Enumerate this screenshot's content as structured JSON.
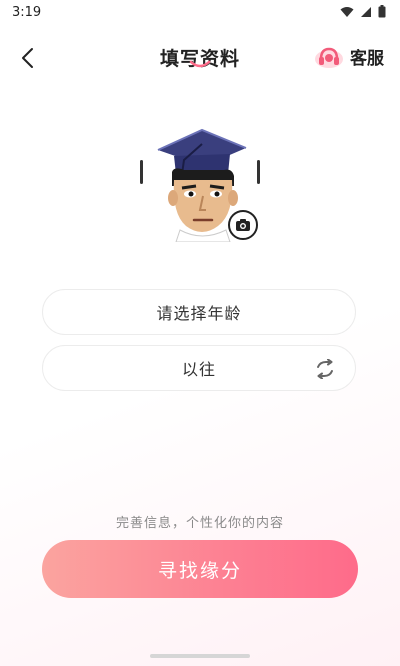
{
  "status_bar": {
    "time": "3:19",
    "icons": [
      "wifi-icon",
      "signal-icon",
      "battery-icon"
    ]
  },
  "nav": {
    "back_icon": "chevron-left-icon",
    "title": "填写资料",
    "service_label": "客服",
    "service_icon": "headset-icon"
  },
  "profile": {
    "avatar": "cartoon-avatar-graduation-cap",
    "camera_icon": "camera-icon"
  },
  "form": {
    "age_field": "请选择年龄",
    "name_field": "以往",
    "refresh_icon": "refresh-icon"
  },
  "hint": "完善信息，个性化你的内容",
  "cta_label": "寻找缘分",
  "colors": {
    "accent_pink": "#fe6b8a",
    "accent_peach": "#fba49f",
    "service_icon": "#f25b7a"
  }
}
